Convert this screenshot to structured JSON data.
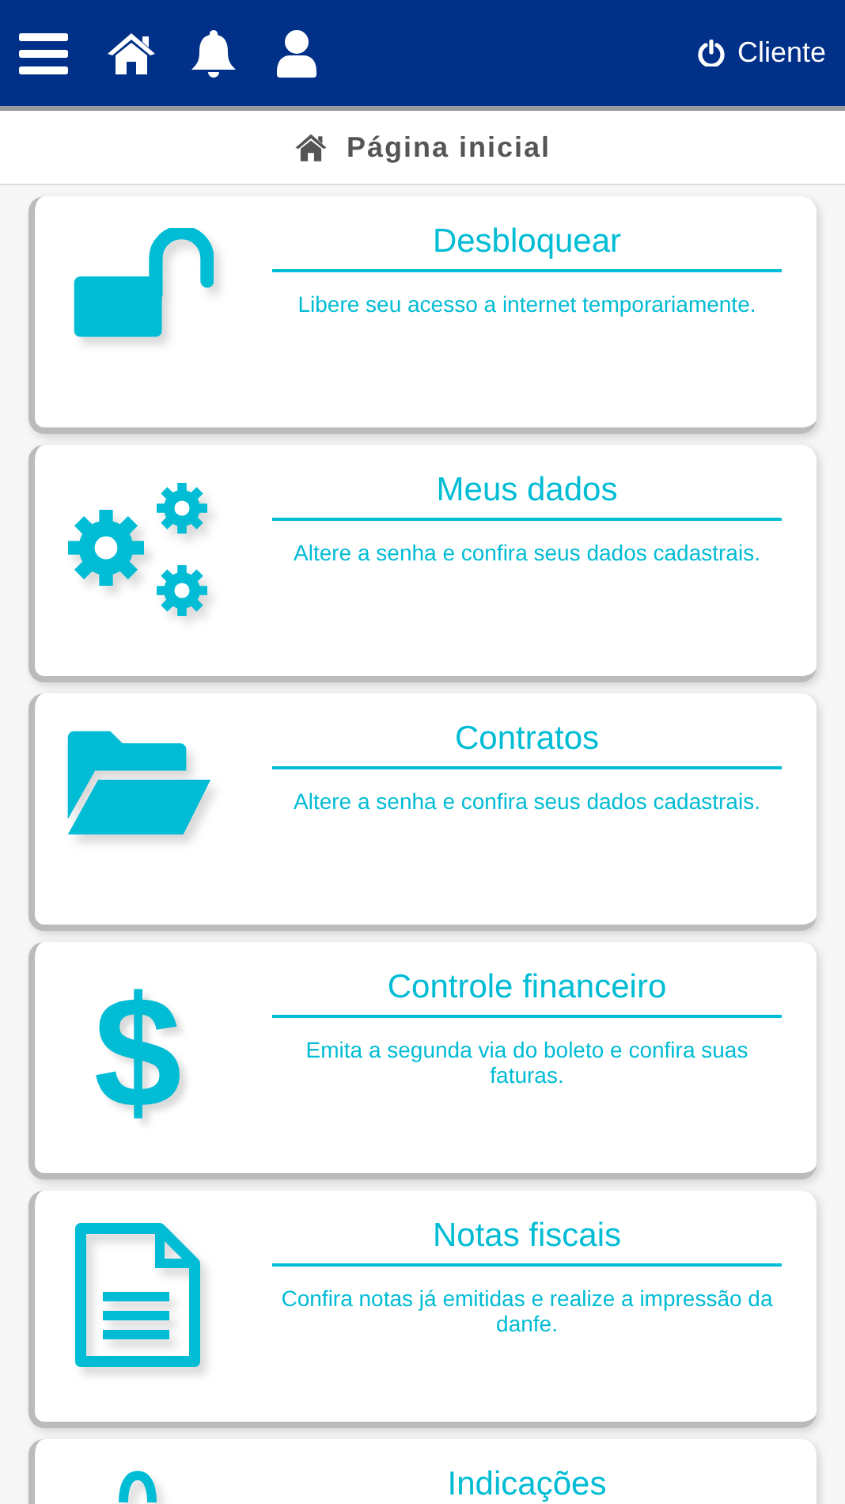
{
  "header": {
    "user_label": "Cliente"
  },
  "page_title": "Página inicial",
  "cards": [
    {
      "kind": "lock",
      "title": "Desbloquear",
      "description": "Libere seu acesso a internet temporariamente."
    },
    {
      "kind": "gears",
      "title": "Meus dados",
      "description": "Altere a senha e confira seus dados cadastrais."
    },
    {
      "kind": "folder",
      "title": "Contratos",
      "description": "Altere a senha e confira seus dados cadastrais."
    },
    {
      "kind": "symbol",
      "symbol": "$",
      "title": "Controle financeiro",
      "description": "Emita a segunda via do boleto e confira suas faturas."
    },
    {
      "kind": "document",
      "title": "Notas fiscais",
      "description": "Confira notas já emitidas e realize a impressão da danfe."
    },
    {
      "kind": "loop",
      "title": "Indicações"
    }
  ]
}
